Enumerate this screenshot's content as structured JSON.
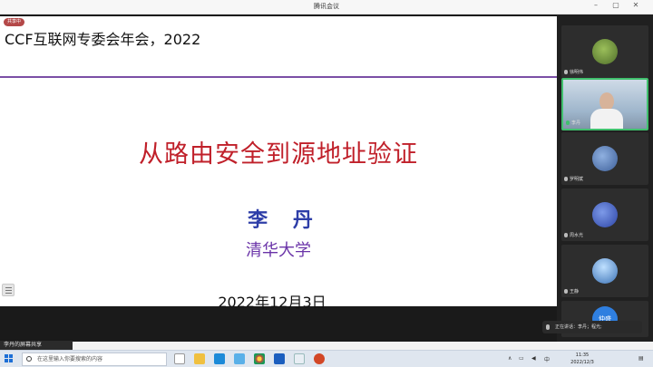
{
  "window": {
    "title": "腾讯会议"
  },
  "share": {
    "badge": "共享中",
    "label": "李丹的屏幕共享"
  },
  "slide": {
    "header": "CCF互联网专委会年会，2022",
    "title": "从路由安全到源地址验证",
    "author": "李 丹",
    "org": "清华大学",
    "date": "2022年12月3日"
  },
  "participants": [
    {
      "name": "徐明伟",
      "avatar_color": "#6a8a3a"
    },
    {
      "name": "李丹",
      "avatar_color": "#8aa6c2"
    },
    {
      "name": "罗明斌",
      "avatar_color": "#5577aa"
    },
    {
      "name": "周水光",
      "avatar_color": "#4466bb"
    },
    {
      "name": "王静",
      "avatar_color": "#3b72b6"
    },
    {
      "name": "仲盛",
      "avatar_color": "#2f7fe0",
      "initials": "仲盛"
    }
  ],
  "speaking": {
    "text": "正在讲话：李丹；程光;"
  },
  "taskbar": {
    "search_placeholder": "在这里输入你要搜索的内容",
    "ime": "中",
    "time": "11:35",
    "date": "2022/12/3"
  }
}
